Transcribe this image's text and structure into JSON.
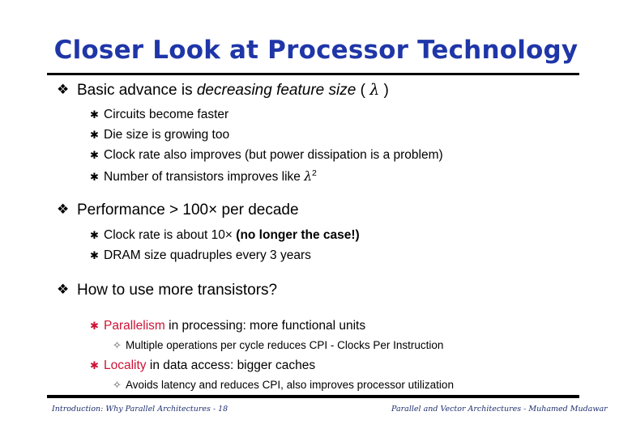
{
  "slide": {
    "title": "Closer Look at Processor Technology",
    "colors": {
      "title_blue": "#1F36A8",
      "accent_red": "#CC1336",
      "footer_blue": "#1F3070",
      "rule_black": "#000000",
      "background": "#FFFFFF"
    },
    "bullets": {
      "level1_glyph": "❖",
      "level2_glyph": "✱",
      "level3_glyph": "✧"
    },
    "content": [
      {
        "level": 1,
        "name": "bullet-basic-advance",
        "segments": [
          {
            "text": "Basic advance is ",
            "style": "plain"
          },
          {
            "text": "decreasing feature size",
            "style": "italic"
          },
          {
            "text": " ( ",
            "style": "plain"
          },
          {
            "text": "λ",
            "style": "symbol"
          },
          {
            "text": " )",
            "style": "plain"
          }
        ],
        "plain": "Basic advance is decreasing feature size ( λ )"
      },
      {
        "level": 2,
        "name": "bullet-circuits-faster",
        "segments": [
          {
            "text": "Circuits become faster",
            "style": "plain"
          }
        ],
        "plain": "Circuits become faster"
      },
      {
        "level": 2,
        "name": "bullet-die-size",
        "segments": [
          {
            "text": "Die size is growing too",
            "style": "plain"
          }
        ],
        "plain": "Die size is growing too"
      },
      {
        "level": 2,
        "name": "bullet-clock-rate-improves",
        "segments": [
          {
            "text": "Clock rate also improves (but power dissipation is a problem)",
            "style": "plain"
          }
        ],
        "plain": "Clock rate also improves (but power dissipation is a problem)"
      },
      {
        "level": 2,
        "name": "bullet-transistor-count",
        "segments": [
          {
            "text": "Number of transistors improves like ",
            "style": "plain"
          },
          {
            "text": "λ",
            "style": "symbol"
          },
          {
            "text": "2",
            "style": "superscript"
          }
        ],
        "plain": "Number of transistors improves like λ2"
      },
      {
        "level": 1,
        "name": "bullet-performance-per-decade",
        "group_start": true,
        "segments": [
          {
            "text": "Performance > 100× per decade",
            "style": "plain"
          }
        ],
        "plain": "Performance > 100× per decade"
      },
      {
        "level": 2,
        "name": "bullet-clock-rate-10x",
        "segments": [
          {
            "text": "Clock rate is about 10× ",
            "style": "plain"
          },
          {
            "text": "(no longer the case!)",
            "style": "bold"
          }
        ],
        "plain": "Clock rate is about 10× (no longer the case!)"
      },
      {
        "level": 2,
        "name": "bullet-dram-quadruples",
        "segments": [
          {
            "text": "DRAM size quadruples every 3 years",
            "style": "plain"
          }
        ],
        "plain": "DRAM size quadruples every 3 years"
      },
      {
        "level": 1,
        "name": "bullet-how-to-use-transistors",
        "group_start": true,
        "segments": [
          {
            "text": "How to use more transistors?",
            "style": "plain"
          }
        ],
        "plain": "How to use more transistors?"
      },
      {
        "level": 2,
        "name": "bullet-parallelism",
        "red": true,
        "group_start_small": true,
        "segments": [
          {
            "text": "Parallelism",
            "style": "emphasis"
          },
          {
            "text": " in processing: more functional units",
            "style": "plain"
          }
        ],
        "plain": "Parallelism in processing: more functional units"
      },
      {
        "level": 3,
        "name": "bullet-multiple-operations-cpi",
        "segments": [
          {
            "text": "Multiple operations per cycle reduces CPI - Clocks Per Instruction",
            "style": "plain"
          }
        ],
        "plain": "Multiple operations per cycle reduces CPI - Clocks Per Instruction"
      },
      {
        "level": 2,
        "name": "bullet-locality",
        "red": true,
        "segments": [
          {
            "text": "Locality",
            "style": "emphasis"
          },
          {
            "text": " in data access: bigger caches",
            "style": "plain"
          }
        ],
        "plain": "Locality in data access: bigger caches"
      },
      {
        "level": 3,
        "name": "bullet-avoids-latency",
        "segments": [
          {
            "text": "Avoids latency and reduces CPI, also improves processor utilization",
            "style": "plain"
          }
        ],
        "plain": "Avoids latency and reduces CPI, also improves processor utilization"
      }
    ],
    "footer": {
      "left": "Introduction: Why Parallel Architectures - 18",
      "right": "Parallel and Vector Architectures - Muhamed Mudawar"
    }
  }
}
